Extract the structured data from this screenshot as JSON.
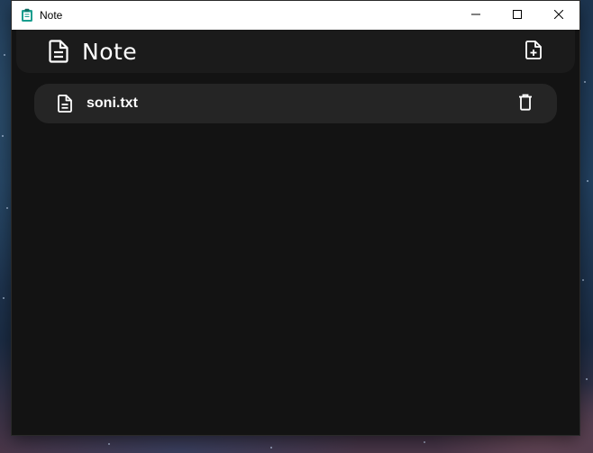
{
  "window": {
    "title": "Note",
    "controls": {
      "minimize_icon": "minimize-icon",
      "maximize_icon": "maximize-icon",
      "close_icon": "close-icon"
    }
  },
  "app": {
    "title": "Note",
    "title_icon": "document-icon",
    "new_note_icon": "file-plus-icon"
  },
  "notes": [
    {
      "name": "soni.txt",
      "icon": "document-icon",
      "action_icon": "trash-icon"
    }
  ],
  "colors": {
    "window_background": "#131313",
    "appbar_background": "#1b1b1b",
    "note_item_background": "#252525",
    "text": "#ffffff",
    "titlebar": "#ffffff",
    "app_icon_accent": "#1a9e8f"
  }
}
